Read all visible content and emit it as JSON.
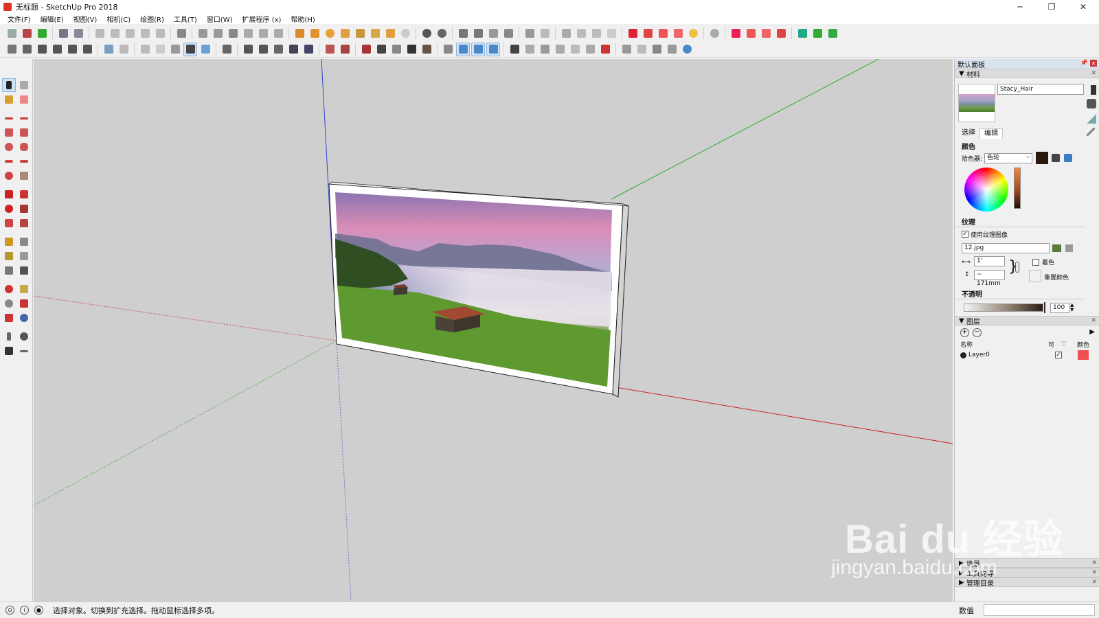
{
  "window": {
    "title": "无标题 - SketchUp Pro 2018",
    "min": "─",
    "restore": "❐",
    "close": "✕"
  },
  "menu": [
    "文件(F)",
    "编辑(E)",
    "视图(V)",
    "相机(C)",
    "绘图(R)",
    "工具(T)",
    "窗口(W)",
    "扩展程序 (x)",
    "帮助(H)"
  ],
  "panel": {
    "title": "默认面板",
    "materials": {
      "header": "材料",
      "name": "Stacy_Hair",
      "tabs": [
        "选择",
        "编辑"
      ],
      "color_label": "颜色",
      "picker_label": "拾色器:",
      "picker_value": "色轮",
      "current_color": "#2a170e",
      "texture_label": "纹理",
      "use_texture_label": "使用纹理图像",
      "texture_file": "12.jpg",
      "width_value": "1'",
      "height_value": "~ 171mm",
      "colorize_label": "着色",
      "reset_color_label": "重置颜色",
      "opacity_label": "不透明",
      "opacity_value": "100"
    },
    "layers": {
      "header": "图层",
      "col_name": "名称",
      "col_visible": "可",
      "col_color": "颜色",
      "rows": [
        {
          "name": "Layer0",
          "visible": true,
          "color": "#f05050"
        }
      ]
    },
    "collapsed_trays": [
      "场景",
      "工具向导",
      "管理目录"
    ]
  },
  "status": {
    "message": "选择对象。切换到扩充选择。拖动鼠标选择多项。",
    "measurements_label": "数值"
  },
  "watermark": {
    "brand": "Bai du 经验",
    "url": "jingyan.baidu.com"
  }
}
